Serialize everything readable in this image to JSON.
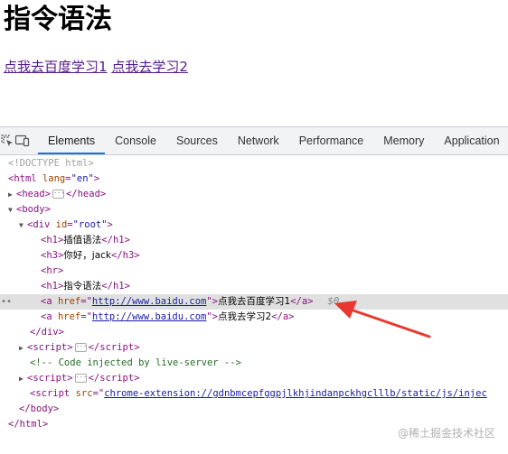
{
  "page": {
    "heading": "指令语法",
    "link1": "点我去百度学习1",
    "link2": "点我去学习2"
  },
  "devtools": {
    "tabs": [
      "Elements",
      "Console",
      "Sources",
      "Network",
      "Performance",
      "Memory",
      "Application"
    ],
    "active_tab": "Elements",
    "accent_color": "#1a73e8"
  },
  "dom": {
    "doctype": "<!DOCTYPE html>",
    "html_open_tag": "<html",
    "html_lang_attr": "lang",
    "html_lang_val": "\"en\"",
    "html_open_end": ">",
    "head": "head",
    "body": "body",
    "div": "div",
    "div_attr": "id",
    "div_val": "\"root\"",
    "h1_text": "插值语法",
    "h3_text": "你好，jack",
    "hr": "<hr>",
    "h1b_text": "指令语法",
    "a_href_attr": "href",
    "a1_href": "http://www.baidu.com",
    "a1_text": "点我去百度学习1",
    "a2_href": "http://www.baidu.com",
    "a2_text": "点我去学习2",
    "selected_marker": "$0",
    "script": "script",
    "comment": "<!-- Code injected by live-server -->",
    "script_src_attr": "src",
    "script_src_val": "chrome-extension://gdnbmcepfggpjlkhjindanpckhgclllb/static/js/injec",
    "body_close": "</body>",
    "html_close": "</html>"
  },
  "watermark": "@稀土掘金技术社区"
}
